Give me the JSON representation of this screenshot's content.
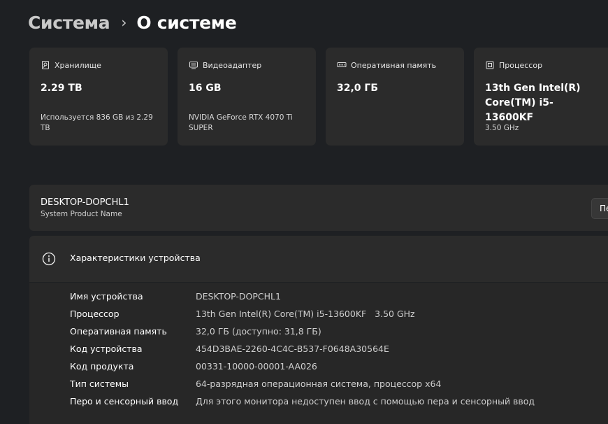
{
  "breadcrumb": {
    "parent": "Система",
    "separator": "›",
    "current": "О системе"
  },
  "cards": [
    {
      "icon": "storage-icon",
      "label": "Хранилище",
      "value": "2.29 TB",
      "sub": "Используется 836 GB из 2.29 TB"
    },
    {
      "icon": "gpu-icon",
      "label": "Видеоадаптер",
      "value": "16 GB",
      "sub": "NVIDIA GeForce RTX 4070 Ti SUPER"
    },
    {
      "icon": "memory-icon",
      "label": "Оперативная память",
      "value": "32,0 ГБ",
      "sub": ""
    },
    {
      "icon": "processor-icon",
      "label": "Процессор",
      "value": "13th Gen Intel(R) Core(TM) i5-13600KF",
      "sub": "3.50 GHz"
    }
  ],
  "device": {
    "name": "DESKTOP-DOPCHL1",
    "model": "System Product Name",
    "rename_label": "Переименовать этот ПК"
  },
  "specs": {
    "title": "Характеристики устройства",
    "rows": [
      {
        "label": "Имя устройства",
        "value": "DESKTOP-DOPCHL1"
      },
      {
        "label": "Процессор",
        "value": "13th Gen Intel(R) Core(TM) i5-13600KF   3.50 GHz"
      },
      {
        "label": "Оперативная память",
        "value": "32,0 ГБ (доступно: 31,8 ГБ)"
      },
      {
        "label": "Код устройства",
        "value": "454D3BAE-2260-4C4C-B537-F0648A30564E"
      },
      {
        "label": "Код продукта",
        "value": "00331-10000-00001-AA026"
      },
      {
        "label": "Тип системы",
        "value": "64-разрядная операционная система, процессор x64"
      },
      {
        "label": "Перо и сенсорный ввод",
        "value": "Для этого монитора недоступен ввод с помощью пера и сенсорный ввод"
      }
    ]
  }
}
